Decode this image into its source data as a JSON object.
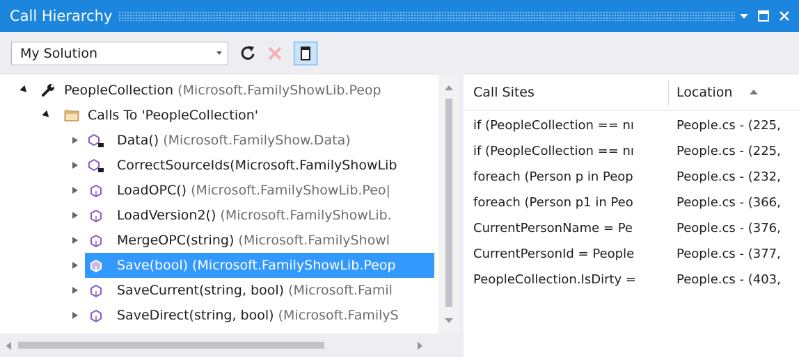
{
  "window": {
    "title": "Call Hierarchy",
    "controls": [
      "pin-dropdown",
      "maximize",
      "close"
    ]
  },
  "toolbar": {
    "scope_value": "My Solution",
    "refresh_icon": "refresh-icon",
    "cancel_icon": "cancel-icon",
    "toggle_details_icon": "toggle-details-icon"
  },
  "tree": {
    "root": {
      "name": "PeopleCollection",
      "detail": "(Microsoft.FamilyShowLib.Peop",
      "icon": "wrench-icon"
    },
    "group": {
      "label": "Calls To 'PeopleCollection'",
      "icon": "folder-icon"
    },
    "items": [
      {
        "name": "Data()",
        "detail": "(Microsoft.FamilyShow.Data)",
        "icon": "private-method-icon"
      },
      {
        "name": "CorrectSourceIds(Microsoft.FamilyShowLib",
        "detail": "",
        "icon": "private-method-icon"
      },
      {
        "name": "LoadOPC()",
        "detail": "(Microsoft.FamilyShowLib.Peo|",
        "icon": "method-icon"
      },
      {
        "name": "LoadVersion2()",
        "detail": "(Microsoft.FamilyShowLib.",
        "icon": "method-icon"
      },
      {
        "name": "MergeOPC(string)",
        "detail": "(Microsoft.FamilyShowl",
        "icon": "method-icon"
      },
      {
        "name": "Save(bool)",
        "detail": "(Microsoft.FamilyShowLib.Peop",
        "icon": "method-icon",
        "selected": true
      },
      {
        "name": "SaveCurrent(string, bool)",
        "detail": "(Microsoft.Famil",
        "icon": "method-icon"
      },
      {
        "name": "SaveDirect(string, bool)",
        "detail": "(Microsoft.FamilyS",
        "icon": "method-icon"
      }
    ]
  },
  "grid": {
    "columns": [
      "Call Sites",
      "Location"
    ],
    "sorted_column": "Location",
    "rows": [
      [
        "if (PeopleCollection == nı",
        "People.cs - (225,"
      ],
      [
        "if (PeopleCollection == nı",
        "People.cs - (225,"
      ],
      [
        "foreach (Person p in Peop",
        "People.cs - (232,"
      ],
      [
        "foreach (Person p1 in Peo",
        "People.cs - (366,"
      ],
      [
        "CurrentPersonName = Pe",
        "People.cs - (376,"
      ],
      [
        "CurrentPersonId = People",
        "People.cs - (377,"
      ],
      [
        "PeopleCollection.IsDirty =",
        "People.cs - (403,"
      ]
    ]
  },
  "colors": {
    "title_bar": "#1c86de",
    "selection": "#3399ff",
    "method_icon": "#8a5cc7",
    "folder_icon": "#dcb67a",
    "cancel_icon": "#f2b3b3"
  }
}
